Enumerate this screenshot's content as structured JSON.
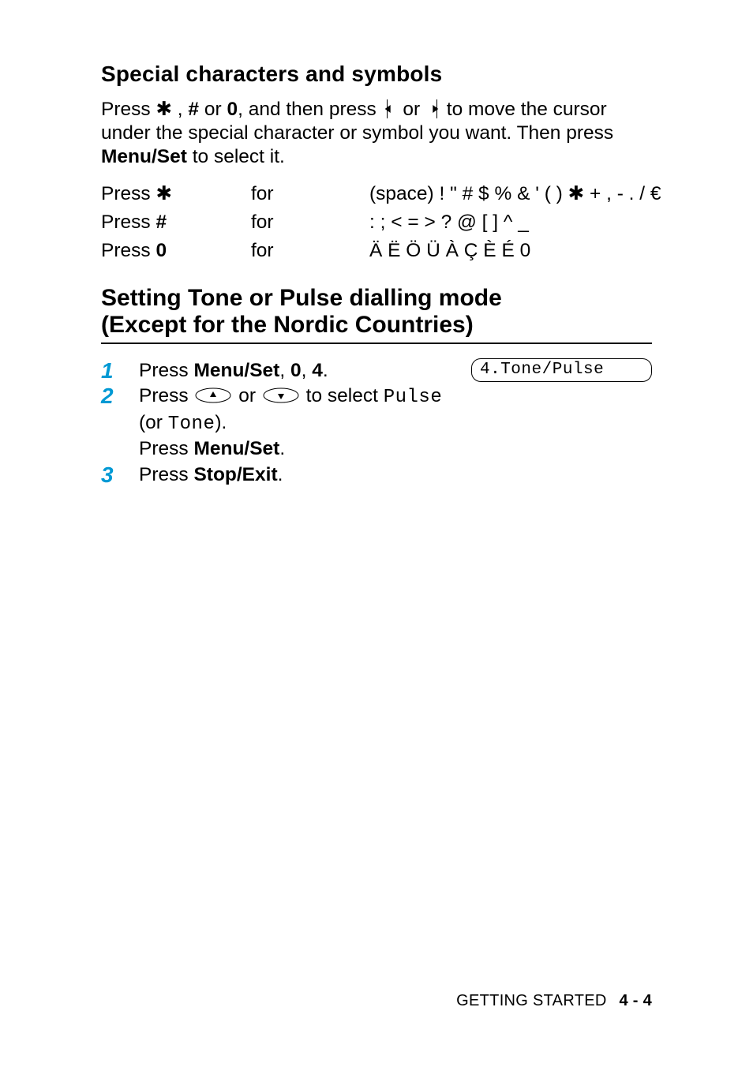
{
  "section1": {
    "heading": "Special characters and symbols",
    "para_parts": {
      "a": "Press ",
      "star": "✱",
      "b": " , ",
      "hash_bold": "#",
      "c": " or ",
      "zero_bold": "0",
      "d": ", and then press ",
      "e": " or ",
      "f": " to move the cursor under the special character or symbol you want. Then press ",
      "menu_set": "Menu/Set",
      "g": " to select it."
    },
    "rows": [
      {
        "c1a": "Press ",
        "c1b": "✱",
        "c2": "for",
        "c3": "(space) ! \" # $ % & ' ( )  ✱  + , - . / €"
      },
      {
        "c1a": "Press ",
        "c1b": "#",
        "c2": "for",
        "c3": ": ; < = > ? @ [ ] ^ _"
      },
      {
        "c1a": "Press ",
        "c1b": "0",
        "c2": "for",
        "c3": "Ä Ë Ö Ü À Ç È É 0"
      }
    ]
  },
  "section2": {
    "heading_line1": "Setting Tone or Pulse dialling mode",
    "heading_line2": "(Except for the Nordic Countries)",
    "lcd": "4.Tone/Pulse",
    "steps": {
      "s1": {
        "num": "1",
        "a": "Press ",
        "menu_set": "Menu/Set",
        "b": ", ",
        "key0": "0",
        "c": ", ",
        "key4": "4",
        "d": "."
      },
      "s2": {
        "num": "2",
        "a": "Press ",
        "b": " or ",
        "c": " to select ",
        "opt1": "Pulse",
        "d": "(or ",
        "opt2": "Tone",
        "e": ").",
        "f": "Press ",
        "menu_set": "Menu/Set",
        "g": "."
      },
      "s3": {
        "num": "3",
        "a": "Press ",
        "stop_exit": "Stop/Exit",
        "b": "."
      }
    }
  },
  "footer": {
    "label": "GETTING STARTED",
    "section": "4 - 4"
  }
}
